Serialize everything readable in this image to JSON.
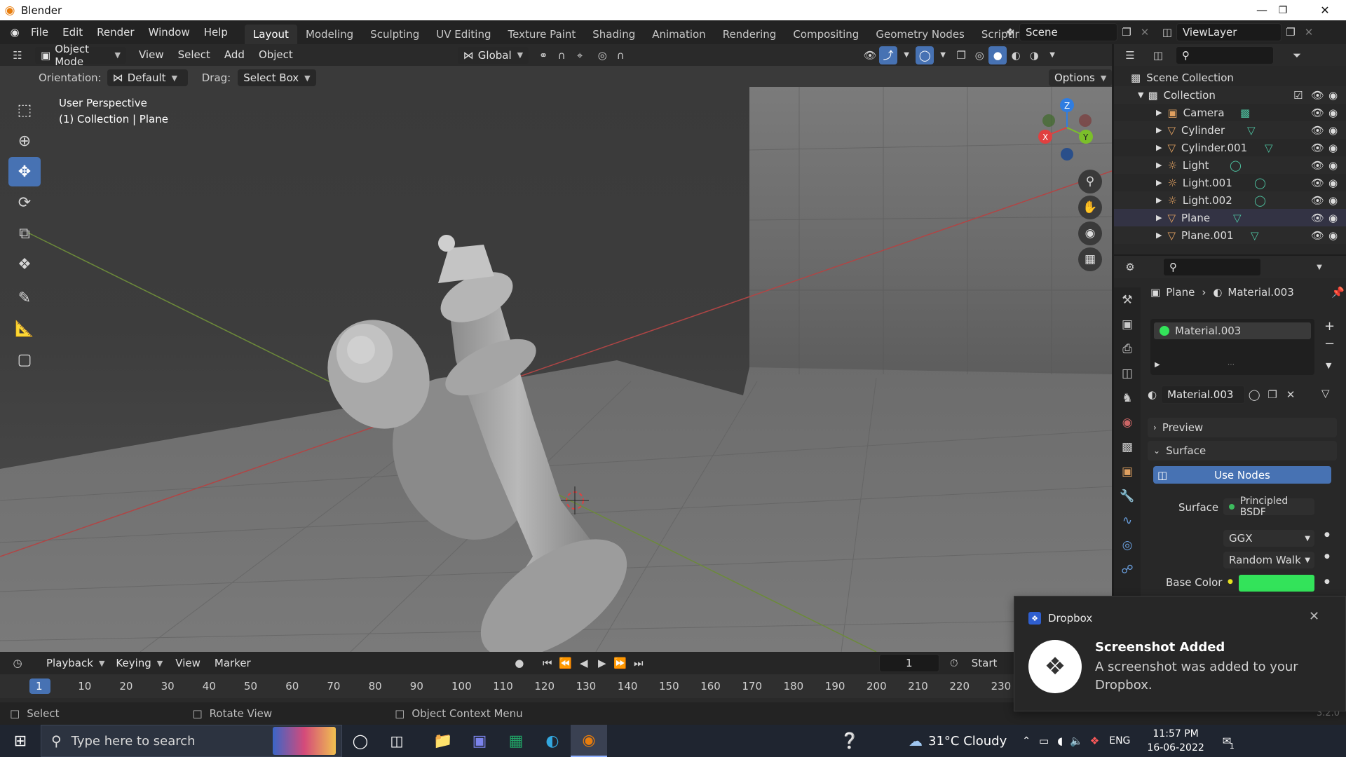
{
  "window": {
    "app_title": "Blender",
    "minimize": "—",
    "maximize": "❐",
    "close": "✕"
  },
  "menu": [
    "File",
    "Edit",
    "Render",
    "Window",
    "Help"
  ],
  "workspaces": [
    "Layout",
    "Modeling",
    "Sculpting",
    "UV Editing",
    "Texture Paint",
    "Shading",
    "Animation",
    "Rendering",
    "Compositing",
    "Geometry Nodes",
    "Scripting"
  ],
  "active_workspace": "Layout",
  "add_workspace": "+",
  "scene": {
    "label": "Scene",
    "view_layer": "ViewLayer"
  },
  "viewport_header": {
    "mode": "Object Mode",
    "menus": [
      "View",
      "Select",
      "Add",
      "Object"
    ],
    "transform_orientation": "Global"
  },
  "tool_settings": {
    "orientation_label": "Orientation:",
    "orientation_value": "Default",
    "drag_label": "Drag:",
    "drag_value": "Select Box",
    "options": "Options"
  },
  "viewport": {
    "perspective": "User Perspective",
    "context": "(1) Collection | Plane",
    "gizmo": {
      "x": "X",
      "y": "Y",
      "z": "Z"
    }
  },
  "outliner": {
    "scene_collection": "Scene Collection",
    "collection": "Collection",
    "objects": [
      "Camera",
      "Cylinder",
      "Cylinder.001",
      "Light",
      "Light.001",
      "Light.002",
      "Plane",
      "Plane.001"
    ]
  },
  "properties": {
    "breadcrumb_object": "Plane",
    "breadcrumb_material": "Material.003",
    "slot": "Material.003",
    "material_name": "Material.003",
    "preview_label": "Preview",
    "surface_panel": "Surface",
    "use_nodes": "Use Nodes",
    "surface_label": "Surface",
    "surface_value": "Principled BSDF",
    "distribution": "GGX",
    "subsurface": "Random Walk",
    "base_color_label": "Base Color",
    "base_color": "#33e35a"
  },
  "timeline": {
    "menus": [
      "Playback",
      "Keying",
      "View",
      "Marker"
    ],
    "current_frame": "1",
    "start_label": "Start",
    "ruler": [
      "1",
      "10",
      "20",
      "30",
      "40",
      "50",
      "60",
      "70",
      "80",
      "90",
      "100",
      "110",
      "120",
      "130",
      "140",
      "150",
      "160",
      "170",
      "180",
      "190",
      "200",
      "210",
      "220",
      "230"
    ]
  },
  "statusbar": {
    "left": "Select",
    "middle": "Rotate View",
    "right": "Object Context Menu",
    "version": "3.2.0"
  },
  "toast": {
    "app": "Dropbox",
    "title": "Screenshot Added",
    "body": "A screenshot was added to your Dropbox."
  },
  "taskbar": {
    "search_placeholder": "Type here to search",
    "weather": "31°C  Cloudy",
    "language": "ENG",
    "time": "11:57 PM",
    "date": "16-06-2022",
    "notification_count": "1"
  },
  "colors": {
    "accent": "#4772b3",
    "active_frame": "#4772b3",
    "blender_orange": "#e87d0d"
  }
}
